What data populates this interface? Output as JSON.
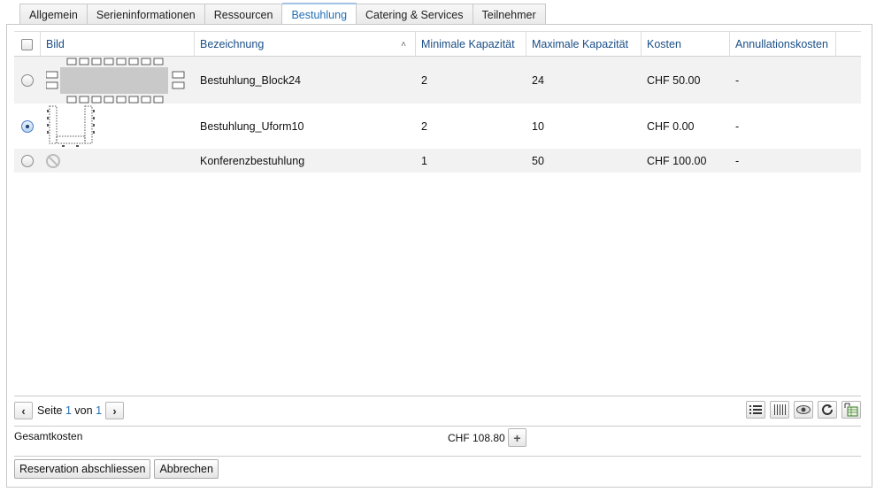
{
  "tabs": [
    "Allgemein",
    "Serieninformationen",
    "Ressourcen",
    "Bestuhlung",
    "Catering & Services",
    "Teilnehmer"
  ],
  "active_tab": "Bestuhlung",
  "grid": {
    "columns": {
      "bild": "Bild",
      "bezeichnung": "Bezeichnung",
      "min_kapazitaet": "Minimale Kapazität",
      "max_kapazitaet": "Maximale Kapazität",
      "kosten": "Kosten",
      "annullationskosten": "Annullationskosten"
    },
    "sorted_column": "Bezeichnung",
    "sort_direction": "ascending",
    "rows": [
      {
        "selected": false,
        "image": "block-layout",
        "bezeichnung": "Bestuhlung_Block24",
        "min": "2",
        "max": "24",
        "kosten": "CHF 50.00",
        "annullation": "-"
      },
      {
        "selected": true,
        "image": "u-form-layout",
        "bezeichnung": "Bestuhlung_Uform10",
        "min": "2",
        "max": "10",
        "kosten": "CHF 0.00",
        "annullation": "-"
      },
      {
        "selected": false,
        "image": "no-image",
        "bezeichnung": "Konferenzbestuhlung",
        "min": "1",
        "max": "50",
        "kosten": "CHF 100.00",
        "annullation": "-"
      }
    ]
  },
  "pager": {
    "seite_label": "Seite",
    "current": "1",
    "von_label": "von",
    "total": "1"
  },
  "toolbar_icons": [
    "list-icon",
    "columns-icon",
    "eye-icon",
    "refresh-icon",
    "export-icon"
  ],
  "totals": {
    "label": "Gesamtkosten",
    "value": "CHF 108.80"
  },
  "actions": {
    "submit": "Reservation abschliessen",
    "cancel": "Abbrechen"
  },
  "colors": {
    "accent": "#1f6fb5",
    "header_text": "#1a4e86",
    "row_alt": "#f2f2f2"
  }
}
